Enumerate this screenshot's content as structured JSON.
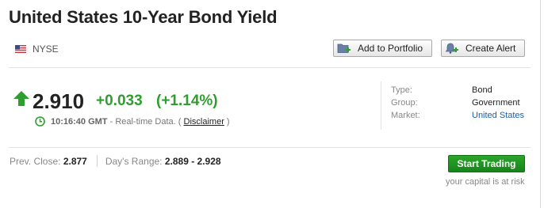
{
  "header": {
    "title": "United States 10-Year Bond Yield"
  },
  "exchange": {
    "flag_icon": "us-flag-icon",
    "label": "NYSE"
  },
  "actions": {
    "add_portfolio_label": "Add to Portfolio",
    "create_alert_label": "Create Alert"
  },
  "quote": {
    "price": "2.910",
    "change": "+0.033",
    "change_percent": "(+1.14%)",
    "direction_icon": "arrow-up-icon",
    "time": "10:16:40 GMT",
    "time_note": "- Real-time Data. (",
    "disclaimer": "Disclaimer",
    "close_paren": ")"
  },
  "info": {
    "type_label": "Type:",
    "type_value": "Bond",
    "group_label": "Group:",
    "group_value": "Government",
    "market_label": "Market:",
    "market_value": "United States"
  },
  "stats": {
    "prev_close_label": "Prev. Close:",
    "prev_close_value": "2.877",
    "days_range_label": "Day's Range:",
    "days_range_value": "2.889 - 2.928"
  },
  "trading": {
    "button_label": "Start Trading",
    "risk_note": "your capital is at risk"
  },
  "colors": {
    "positive": "#2e9e2e",
    "link": "#1a5fad",
    "button_green": "#1f9a22"
  }
}
